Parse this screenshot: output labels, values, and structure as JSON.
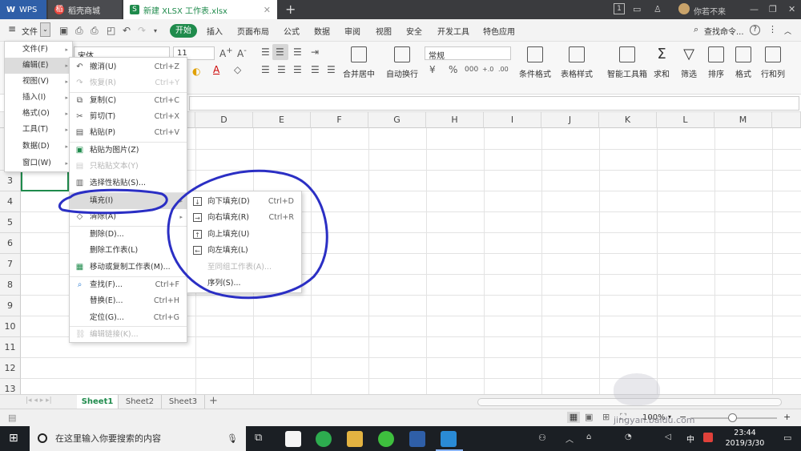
{
  "titlebar": {
    "wps_label": "WPS",
    "tabs": [
      {
        "label": "稻壳商城",
        "icon": "daoke-icon"
      },
      {
        "label": "新建 XLSX 工作表.xlsx",
        "icon": "sheet-doc-icon"
      }
    ],
    "new_tab": "+",
    "window_count": "1",
    "user": "你若不来"
  },
  "menubar": {
    "file_label": "文件",
    "items": [
      "开始",
      "插入",
      "页面布局",
      "公式",
      "数据",
      "审阅",
      "视图",
      "安全",
      "开发工具",
      "特色应用"
    ],
    "search": "查找命令..."
  },
  "ribbon": {
    "font": "宋体",
    "size": "11",
    "number_format": "常规",
    "groups": [
      "合并居中",
      "自动换行",
      "条件格式",
      "表格样式",
      "智能工具箱",
      "求和",
      "筛选",
      "排序",
      "格式",
      "行和列"
    ]
  },
  "grid": {
    "columns": [
      "D",
      "E",
      "F",
      "G",
      "H",
      "I",
      "J",
      "K",
      "L",
      "M"
    ],
    "rows": [
      "3",
      "4",
      "5",
      "6",
      "7",
      "8",
      "9",
      "10",
      "11",
      "12",
      "13"
    ]
  },
  "sheets": [
    "Sheet1",
    "Sheet2",
    "Sheet3"
  ],
  "status": {
    "zoom": "100%"
  },
  "taskbar": {
    "search_placeholder": "在这里输入你要搜索的内容",
    "ime": "中",
    "time": "23:44",
    "date": "2019/3/30"
  },
  "watermark": "jingyan.baidu.com",
  "main_menu": {
    "items": [
      {
        "label": "文件(F)"
      },
      {
        "label": "编辑(E)"
      },
      {
        "label": "视图(V)"
      },
      {
        "label": "插入(I)"
      },
      {
        "label": "格式(O)"
      },
      {
        "label": "工具(T)"
      },
      {
        "label": "数据(D)"
      },
      {
        "label": "窗口(W)"
      }
    ]
  },
  "edit_menu": {
    "items": [
      {
        "label": "撤消(U)",
        "shortcut": "Ctrl+Z",
        "icon": "undo-icon",
        "disabled": false
      },
      {
        "label": "恢复(R)",
        "shortcut": "Ctrl+Y",
        "icon": "redo-icon",
        "disabled": true
      },
      {
        "label": "复制(C)",
        "shortcut": "Ctrl+C",
        "icon": "copy-icon",
        "disabled": false
      },
      {
        "label": "剪切(T)",
        "shortcut": "Ctrl+X",
        "icon": "cut-icon",
        "disabled": false
      },
      {
        "label": "粘贴(P)",
        "shortcut": "Ctrl+V",
        "icon": "paste-icon",
        "disabled": false
      },
      {
        "label": "粘贴为图片(Z)",
        "shortcut": "",
        "icon": "paste-image-icon",
        "disabled": false
      },
      {
        "label": "只粘贴文本(Y)",
        "shortcut": "",
        "icon": "paste-text-icon",
        "disabled": true
      },
      {
        "label": "选择性粘贴(S)...",
        "shortcut": "",
        "icon": "paste-special-icon",
        "disabled": false
      },
      {
        "label": "填充(I)",
        "shortcut": "",
        "icon": "",
        "disabled": false
      },
      {
        "label": "清除(A)",
        "shortcut": "",
        "icon": "clear-icon",
        "disabled": false
      },
      {
        "label": "删除(D)...",
        "shortcut": "",
        "icon": "",
        "disabled": false
      },
      {
        "label": "删除工作表(L)",
        "shortcut": "",
        "icon": "",
        "disabled": false
      },
      {
        "label": "移动或复制工作表(M)...",
        "shortcut": "",
        "icon": "move-sheet-icon",
        "disabled": false
      },
      {
        "label": "查找(F)...",
        "shortcut": "Ctrl+F",
        "icon": "find-icon",
        "disabled": false
      },
      {
        "label": "替换(E)...",
        "shortcut": "Ctrl+H",
        "icon": "",
        "disabled": false
      },
      {
        "label": "定位(G)...",
        "shortcut": "Ctrl+G",
        "icon": "",
        "disabled": false
      },
      {
        "label": "编辑链接(K)...",
        "shortcut": "",
        "icon": "edit-link-icon",
        "disabled": true
      }
    ]
  },
  "fill_menu": {
    "items": [
      {
        "label": "向下填充(D)",
        "shortcut": "Ctrl+D",
        "disabled": false
      },
      {
        "label": "向右填充(R)",
        "shortcut": "Ctrl+R",
        "disabled": false
      },
      {
        "label": "向上填充(U)",
        "shortcut": "",
        "disabled": false
      },
      {
        "label": "向左填充(L)",
        "shortcut": "",
        "disabled": false
      },
      {
        "label": "至同组工作表(A)...",
        "shortcut": "",
        "disabled": true
      },
      {
        "label": "序列(S)...",
        "shortcut": "",
        "disabled": false
      }
    ]
  },
  "colors": {
    "accent": "#1f8b4c",
    "annotation": "#2b2fc4"
  }
}
